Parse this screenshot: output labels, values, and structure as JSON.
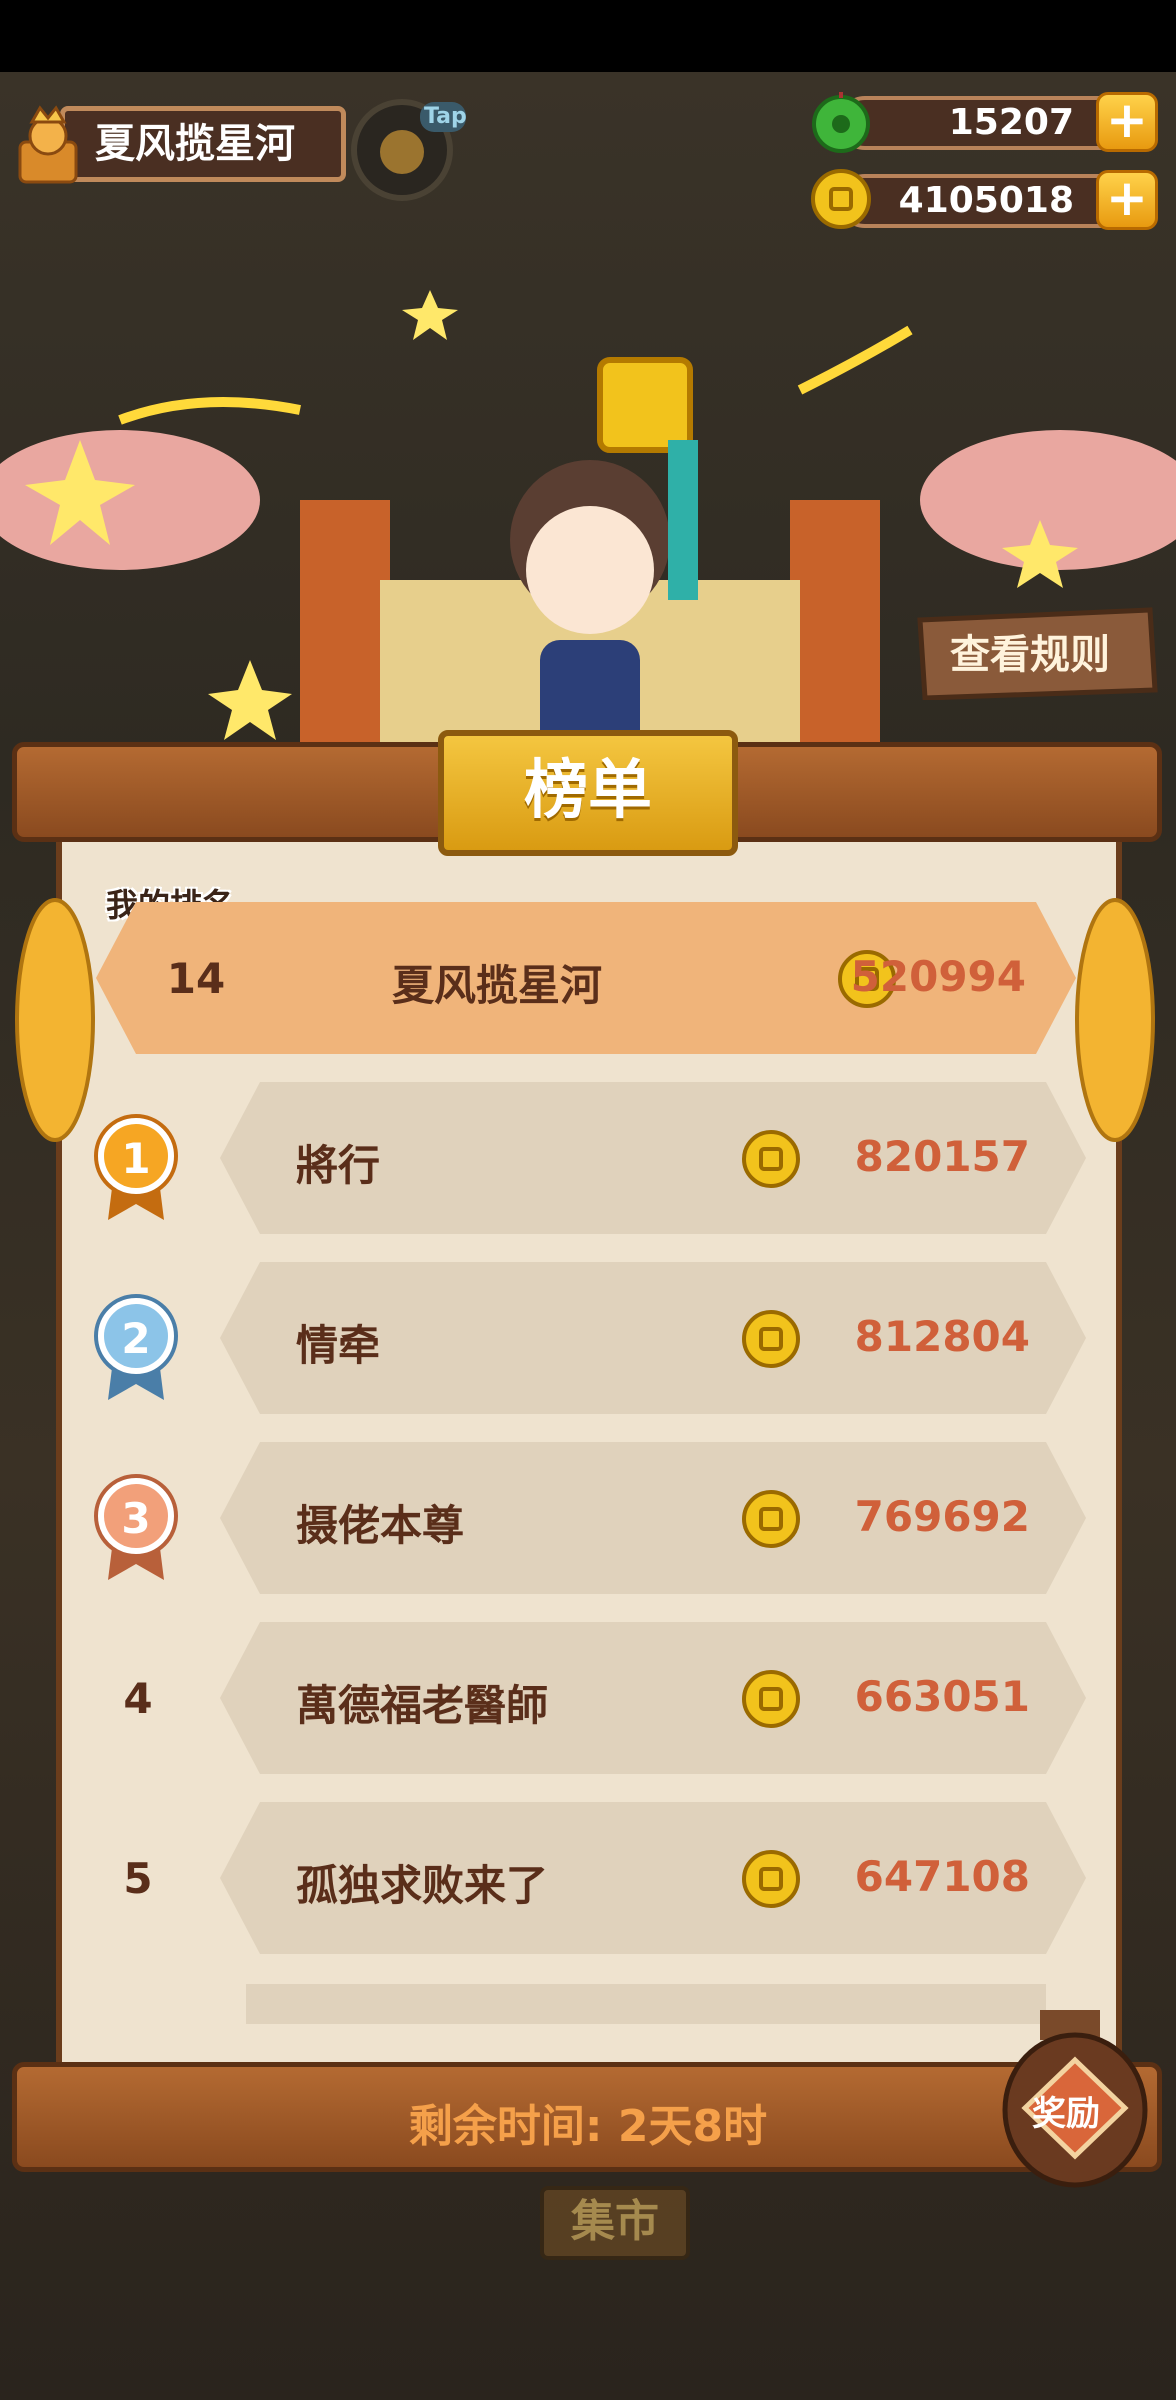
{
  "player": {
    "name": "夏风揽星河"
  },
  "tap_label": "Tap",
  "currencies": [
    {
      "name": "jade",
      "value": "15207",
      "icon": "jade-icon"
    },
    {
      "name": "coins",
      "value": "4105018",
      "icon": "coin-icon"
    }
  ],
  "rules_button": "查看规则",
  "board": {
    "title": "榜单",
    "my_rank_label": "我的排名",
    "my_row": {
      "rank": "14",
      "name": "夏风揽星河",
      "score": "520994"
    },
    "rows": [
      {
        "rank": "1",
        "name": "將行",
        "score": "820157",
        "medal": "gold"
      },
      {
        "rank": "2",
        "name": "情牵",
        "score": "812804",
        "medal": "silver"
      },
      {
        "rank": "3",
        "name": "摄佬本尊",
        "score": "769692",
        "medal": "bronze"
      },
      {
        "rank": "4",
        "name": "萬德福老醫師",
        "score": "663051"
      },
      {
        "rank": "5",
        "name": "孤独求败来了",
        "score": "647108"
      }
    ]
  },
  "remaining_time": "剩余时间: 2天8时",
  "reward_button": "奖励",
  "market_label": "集市",
  "colors": {
    "score": "#d0603a",
    "name": "#5a2e1a",
    "gold": "#f0b418"
  }
}
